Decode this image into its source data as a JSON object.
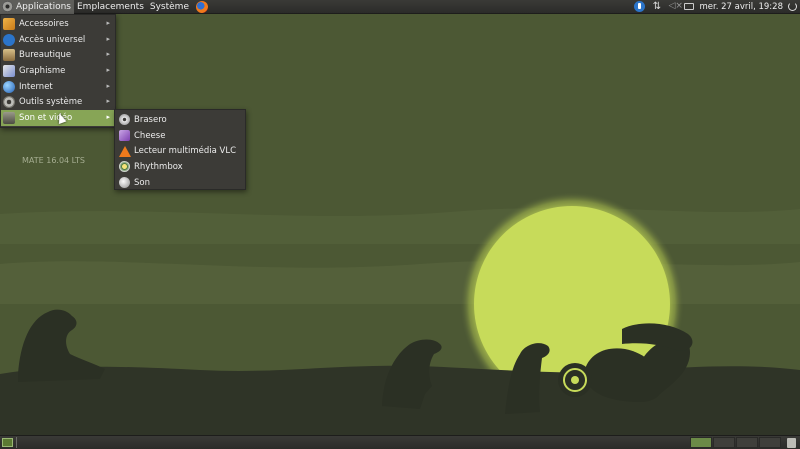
{
  "top_panel": {
    "menus": [
      "Applications",
      "Emplacements",
      "Système"
    ],
    "clock": "mer. 27 avril, 19:28",
    "tray_icons": [
      "accessibility-icon",
      "network-icon",
      "volume-icon",
      "battery-icon",
      "power-icon"
    ]
  },
  "apps_menu": {
    "items": [
      {
        "label": "Accessoires",
        "icon": "accessories-icon"
      },
      {
        "label": "Accès universel",
        "icon": "universal-access-icon"
      },
      {
        "label": "Bureautique",
        "icon": "office-icon"
      },
      {
        "label": "Graphisme",
        "icon": "graphics-icon"
      },
      {
        "label": "Internet",
        "icon": "internet-icon"
      },
      {
        "label": "Outils système",
        "icon": "system-tools-icon"
      },
      {
        "label": "Son et vidéo",
        "icon": "sound-video-icon",
        "highlighted": true
      }
    ]
  },
  "submenu": {
    "items": [
      {
        "label": "Brasero",
        "icon": "brasero-icon"
      },
      {
        "label": "Cheese",
        "icon": "cheese-icon"
      },
      {
        "label": "Lecteur multimédia VLC",
        "icon": "vlc-icon"
      },
      {
        "label": "Rhythmbox",
        "icon": "rhythmbox-icon"
      },
      {
        "label": "Son",
        "icon": "sound-icon"
      }
    ]
  },
  "desktop": {
    "label": "MATE 16.04 LTS"
  },
  "colors": {
    "highlight": "#87a556",
    "menu_bg": "#3c3b37",
    "panel_bg": "#2b2b29",
    "sun": "#c9dc5a",
    "sky": "#4e5a36"
  }
}
